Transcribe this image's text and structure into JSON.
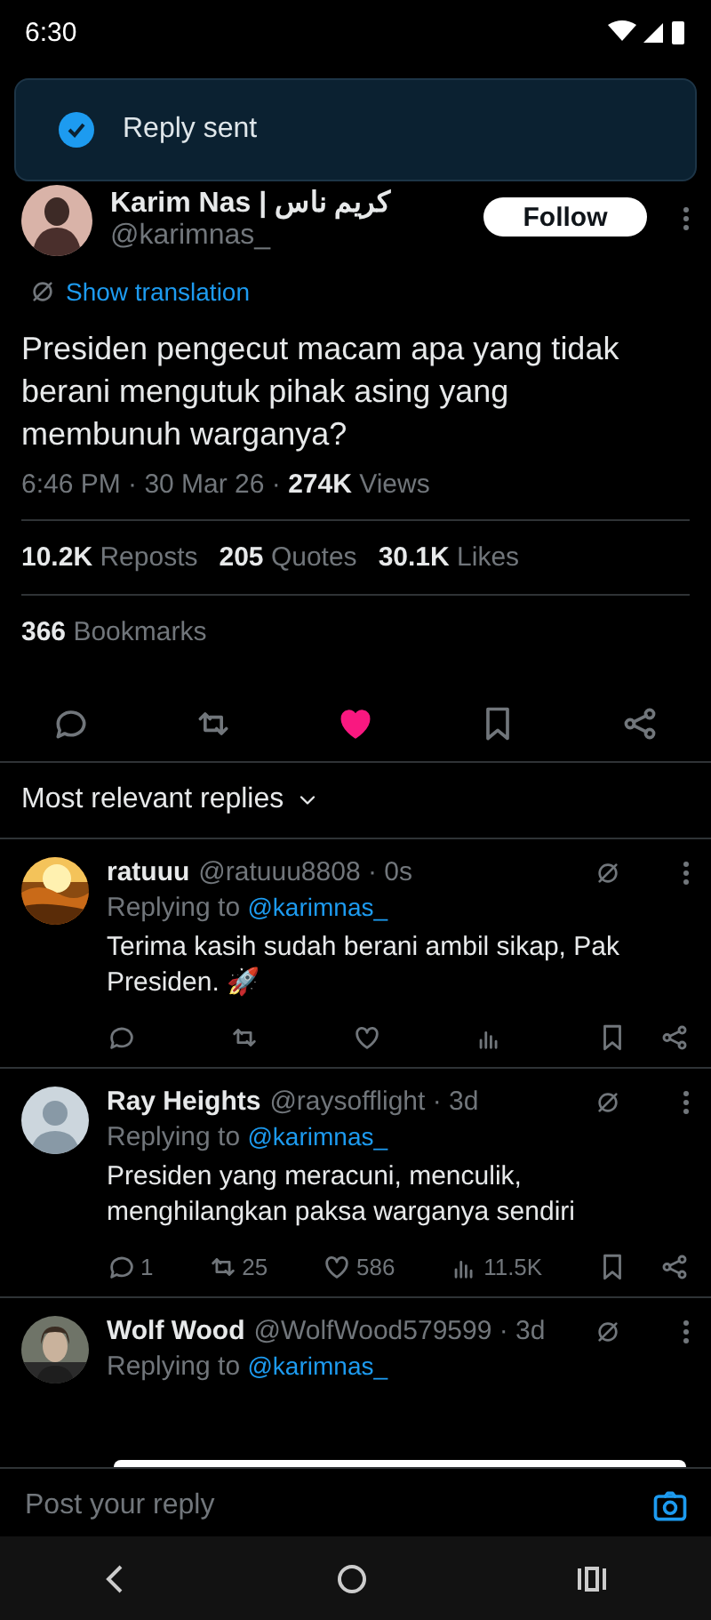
{
  "status_bar": {
    "time": "6:30"
  },
  "toast": {
    "text": "Reply sent"
  },
  "tweet": {
    "author_name": "Karim Nas | كريم ناس",
    "handle": "@karimnas_",
    "follow_label": "Follow",
    "translation_link": "Show translation",
    "body": "Presiden pengecut macam apa yang tidak berani mengutuk pihak asing yang membunuh warganya?",
    "meta": "6:46 PM · 30 Mar 26 · **274K** Views",
    "stats": [
      {
        "count": "10.2K",
        "label": "Reposts"
      },
      {
        "count": "205",
        "label": "Quotes"
      },
      {
        "count": "30.1K",
        "label": "Likes"
      }
    ],
    "bookmarks": {
      "count": "366",
      "label": "Bookmarks"
    },
    "liked": true
  },
  "replies_sort": "Most relevant replies",
  "replies": [
    {
      "avatar": {
        "kind": "sun"
      },
      "name": "ratuuu",
      "handle": "@ratuuu8808 · 0s",
      "replying_label": "Replying to",
      "replying_handle": "@karimnas_",
      "text": "Terima kasih sudah berani ambil sikap, Pak Presiden. 🚀",
      "actions": [
        {
          "kind": "reply"
        },
        {
          "kind": "repost"
        },
        {
          "kind": "like"
        },
        {
          "kind": "views"
        }
      ]
    },
    {
      "avatar": {
        "kind": "default"
      },
      "name": "Ray Heights",
      "handle": "@raysofflight · 3d",
      "replying_label": "Replying to",
      "replying_handle": "@karimnas_",
      "text": "Presiden yang meracuni, menculik, menghilangkan paksa warganya sendiri",
      "actions": [
        {
          "kind": "reply",
          "count": "1"
        },
        {
          "kind": "repost",
          "count": "25"
        },
        {
          "kind": "like",
          "count": "586"
        },
        {
          "kind": "views",
          "count": "11.5K"
        }
      ]
    },
    {
      "avatar": {
        "kind": "person"
      },
      "name": "Wolf Wood",
      "handle": "@WolfWood579599 · 3d",
      "replying_label": "Replying to",
      "replying_handle": "@karimnas_"
    }
  ],
  "reply_box": {
    "placeholder": "Post your reply"
  }
}
